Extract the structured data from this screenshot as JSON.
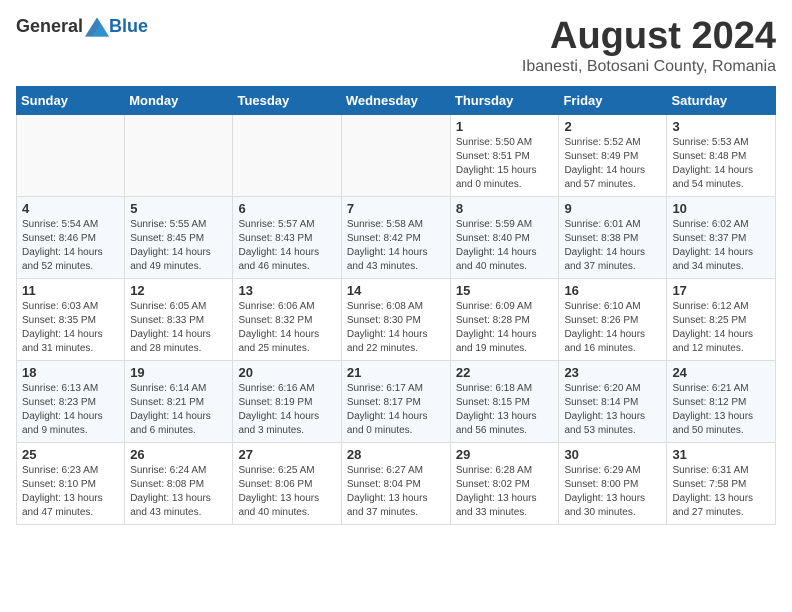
{
  "header": {
    "logo": {
      "general": "General",
      "blue": "Blue"
    },
    "title": "August 2024",
    "subtitle": "Ibanesti, Botosani County, Romania"
  },
  "calendar": {
    "days_of_week": [
      "Sunday",
      "Monday",
      "Tuesday",
      "Wednesday",
      "Thursday",
      "Friday",
      "Saturday"
    ],
    "weeks": [
      [
        {
          "day": "",
          "info": ""
        },
        {
          "day": "",
          "info": ""
        },
        {
          "day": "",
          "info": ""
        },
        {
          "day": "",
          "info": ""
        },
        {
          "day": "1",
          "info": "Sunrise: 5:50 AM\nSunset: 8:51 PM\nDaylight: 15 hours\nand 0 minutes."
        },
        {
          "day": "2",
          "info": "Sunrise: 5:52 AM\nSunset: 8:49 PM\nDaylight: 14 hours\nand 57 minutes."
        },
        {
          "day": "3",
          "info": "Sunrise: 5:53 AM\nSunset: 8:48 PM\nDaylight: 14 hours\nand 54 minutes."
        }
      ],
      [
        {
          "day": "4",
          "info": "Sunrise: 5:54 AM\nSunset: 8:46 PM\nDaylight: 14 hours\nand 52 minutes."
        },
        {
          "day": "5",
          "info": "Sunrise: 5:55 AM\nSunset: 8:45 PM\nDaylight: 14 hours\nand 49 minutes."
        },
        {
          "day": "6",
          "info": "Sunrise: 5:57 AM\nSunset: 8:43 PM\nDaylight: 14 hours\nand 46 minutes."
        },
        {
          "day": "7",
          "info": "Sunrise: 5:58 AM\nSunset: 8:42 PM\nDaylight: 14 hours\nand 43 minutes."
        },
        {
          "day": "8",
          "info": "Sunrise: 5:59 AM\nSunset: 8:40 PM\nDaylight: 14 hours\nand 40 minutes."
        },
        {
          "day": "9",
          "info": "Sunrise: 6:01 AM\nSunset: 8:38 PM\nDaylight: 14 hours\nand 37 minutes."
        },
        {
          "day": "10",
          "info": "Sunrise: 6:02 AM\nSunset: 8:37 PM\nDaylight: 14 hours\nand 34 minutes."
        }
      ],
      [
        {
          "day": "11",
          "info": "Sunrise: 6:03 AM\nSunset: 8:35 PM\nDaylight: 14 hours\nand 31 minutes."
        },
        {
          "day": "12",
          "info": "Sunrise: 6:05 AM\nSunset: 8:33 PM\nDaylight: 14 hours\nand 28 minutes."
        },
        {
          "day": "13",
          "info": "Sunrise: 6:06 AM\nSunset: 8:32 PM\nDaylight: 14 hours\nand 25 minutes."
        },
        {
          "day": "14",
          "info": "Sunrise: 6:08 AM\nSunset: 8:30 PM\nDaylight: 14 hours\nand 22 minutes."
        },
        {
          "day": "15",
          "info": "Sunrise: 6:09 AM\nSunset: 8:28 PM\nDaylight: 14 hours\nand 19 minutes."
        },
        {
          "day": "16",
          "info": "Sunrise: 6:10 AM\nSunset: 8:26 PM\nDaylight: 14 hours\nand 16 minutes."
        },
        {
          "day": "17",
          "info": "Sunrise: 6:12 AM\nSunset: 8:25 PM\nDaylight: 14 hours\nand 12 minutes."
        }
      ],
      [
        {
          "day": "18",
          "info": "Sunrise: 6:13 AM\nSunset: 8:23 PM\nDaylight: 14 hours\nand 9 minutes."
        },
        {
          "day": "19",
          "info": "Sunrise: 6:14 AM\nSunset: 8:21 PM\nDaylight: 14 hours\nand 6 minutes."
        },
        {
          "day": "20",
          "info": "Sunrise: 6:16 AM\nSunset: 8:19 PM\nDaylight: 14 hours\nand 3 minutes."
        },
        {
          "day": "21",
          "info": "Sunrise: 6:17 AM\nSunset: 8:17 PM\nDaylight: 14 hours\nand 0 minutes."
        },
        {
          "day": "22",
          "info": "Sunrise: 6:18 AM\nSunset: 8:15 PM\nDaylight: 13 hours\nand 56 minutes."
        },
        {
          "day": "23",
          "info": "Sunrise: 6:20 AM\nSunset: 8:14 PM\nDaylight: 13 hours\nand 53 minutes."
        },
        {
          "day": "24",
          "info": "Sunrise: 6:21 AM\nSunset: 8:12 PM\nDaylight: 13 hours\nand 50 minutes."
        }
      ],
      [
        {
          "day": "25",
          "info": "Sunrise: 6:23 AM\nSunset: 8:10 PM\nDaylight: 13 hours\nand 47 minutes."
        },
        {
          "day": "26",
          "info": "Sunrise: 6:24 AM\nSunset: 8:08 PM\nDaylight: 13 hours\nand 43 minutes."
        },
        {
          "day": "27",
          "info": "Sunrise: 6:25 AM\nSunset: 8:06 PM\nDaylight: 13 hours\nand 40 minutes."
        },
        {
          "day": "28",
          "info": "Sunrise: 6:27 AM\nSunset: 8:04 PM\nDaylight: 13 hours\nand 37 minutes."
        },
        {
          "day": "29",
          "info": "Sunrise: 6:28 AM\nSunset: 8:02 PM\nDaylight: 13 hours\nand 33 minutes."
        },
        {
          "day": "30",
          "info": "Sunrise: 6:29 AM\nSunset: 8:00 PM\nDaylight: 13 hours\nand 30 minutes."
        },
        {
          "day": "31",
          "info": "Sunrise: 6:31 AM\nSunset: 7:58 PM\nDaylight: 13 hours\nand 27 minutes."
        }
      ]
    ]
  }
}
